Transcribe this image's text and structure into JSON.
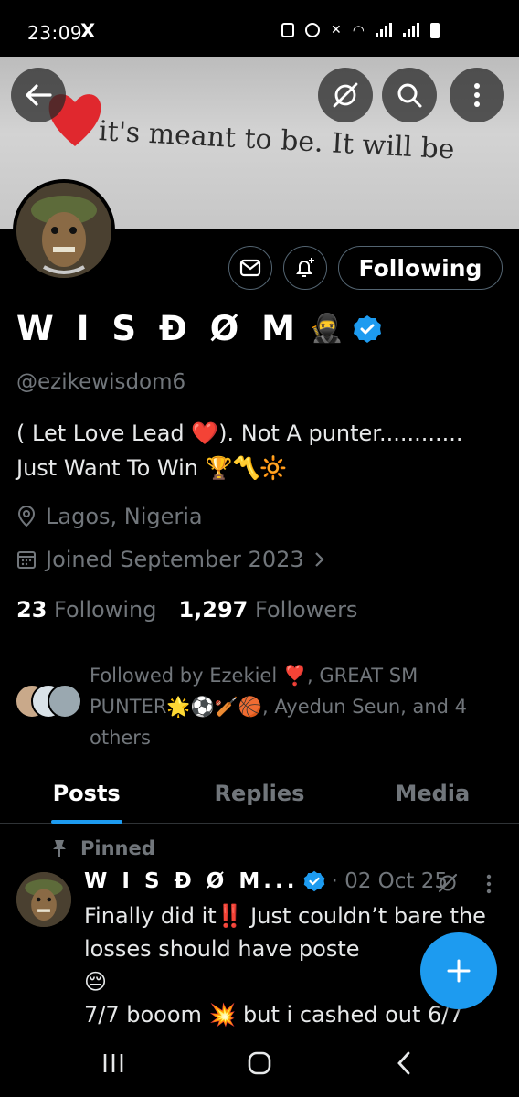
{
  "status_bar": {
    "time": "23:09",
    "notif_app": "X"
  },
  "banner": {
    "text": "it's meant to be. It will be"
  },
  "profile": {
    "display_name": "W I S Đ Ø M",
    "name_emoji": "🥷",
    "handle": "@ezikewisdom6",
    "bio_line1": "( Let Love Lead ❤️). Not A punter............",
    "bio_line2": "Just Want To Win 🏆〽️🔆",
    "location": "Lagos, Nigeria",
    "joined": "Joined September 2023",
    "following_count": "23",
    "following_label": "Following",
    "followers_count": "1,297",
    "followers_label": "Followers",
    "followed_by": "Followed by Ezekiel ❣️, GREAT SM PUNTER🌟⚽🏏🏀, Ayedun Seun, and 4 others"
  },
  "actions": {
    "following_button": "Following"
  },
  "tabs": [
    {
      "label": "Posts",
      "active": true
    },
    {
      "label": "Replies",
      "active": false
    },
    {
      "label": "Media",
      "active": false
    }
  ],
  "tweet": {
    "pinned_label": "Pinned",
    "author": "W I S Đ Ø M...",
    "date": "· 02 Oct 25",
    "body": "Finally did it‼️ Just couldn’t bare the losses should have poste\n😔\n7/7 booom 💥 but i cashed out 6/7"
  },
  "colors": {
    "accent": "#1d9bf0",
    "muted": "#71767b",
    "background": "#000000"
  }
}
